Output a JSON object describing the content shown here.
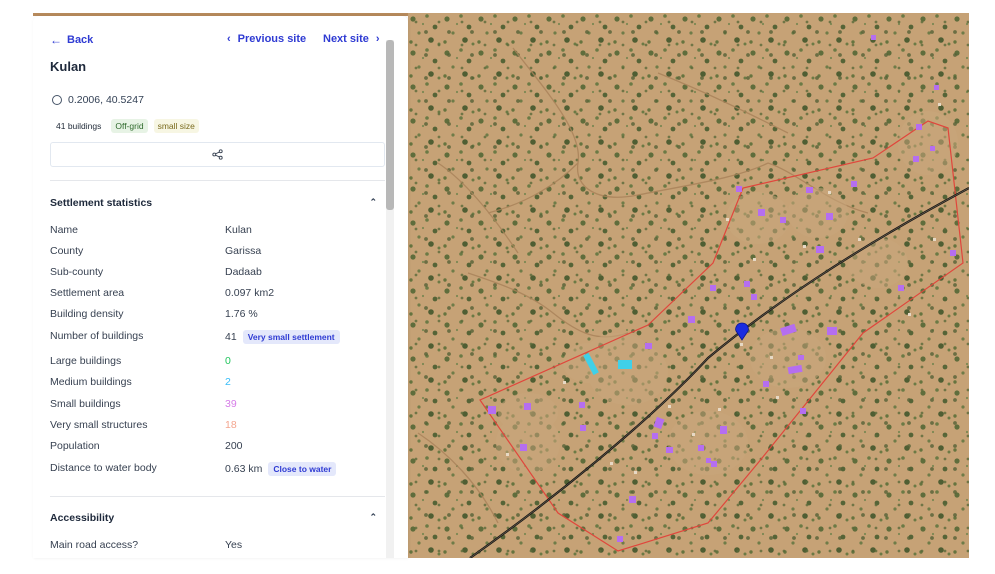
{
  "nav": {
    "back_label": "Back",
    "prev_label": "Previous site",
    "next_label": "Next site"
  },
  "site": {
    "name": "Kulan",
    "coordinates": "0.2006, 40.5247",
    "tags": [
      "41 buildings",
      "Off-grid",
      "small size"
    ]
  },
  "sections": {
    "stats_title": "Settlement statistics",
    "access_title": "Accessibility"
  },
  "stats": [
    {
      "label": "Name",
      "value": "Kulan",
      "color": "#374151"
    },
    {
      "label": "County",
      "value": "Garissa",
      "color": "#374151"
    },
    {
      "label": "Sub-county",
      "value": "Dadaab",
      "color": "#374151"
    },
    {
      "label": "Settlement area",
      "value": "0.097 km2",
      "color": "#374151"
    },
    {
      "label": "Building density",
      "value": "1.76 %",
      "color": "#374151"
    },
    {
      "label": "Number of buildings",
      "value": "41",
      "chip": "Very small settlement",
      "color": "#374151"
    },
    {
      "label": "Large buildings",
      "value": "0",
      "color": "#22c55e"
    },
    {
      "label": "Medium buildings",
      "value": "2",
      "color": "#38bdf8"
    },
    {
      "label": "Small buildings",
      "value": "39",
      "color": "#d67ce8"
    },
    {
      "label": "Very small structures",
      "value": "18",
      "color": "#f4a58e"
    },
    {
      "label": "Population",
      "value": "200",
      "color": "#374151"
    },
    {
      "label": "Distance to water body",
      "value": "0.63 km",
      "chip": "Close to water",
      "color": "#374151"
    }
  ],
  "accessibility": [
    {
      "label": "Main road access?",
      "value": "Yes"
    }
  ],
  "icons": {
    "back": "arrow-left-icon",
    "prev": "chevron-left-icon",
    "next": "chevron-right-icon",
    "share": "share-icon",
    "coords": "circle-icon",
    "collapse": "chevron-up-icon",
    "pin": "map-pin-icon"
  },
  "colors": {
    "accent": "#2f3bd3",
    "boundary": "#e0463c",
    "small_building": "#b56ef0",
    "medium_building": "#3fd0e8",
    "road": "#111111",
    "pin": "#1a2be0"
  }
}
